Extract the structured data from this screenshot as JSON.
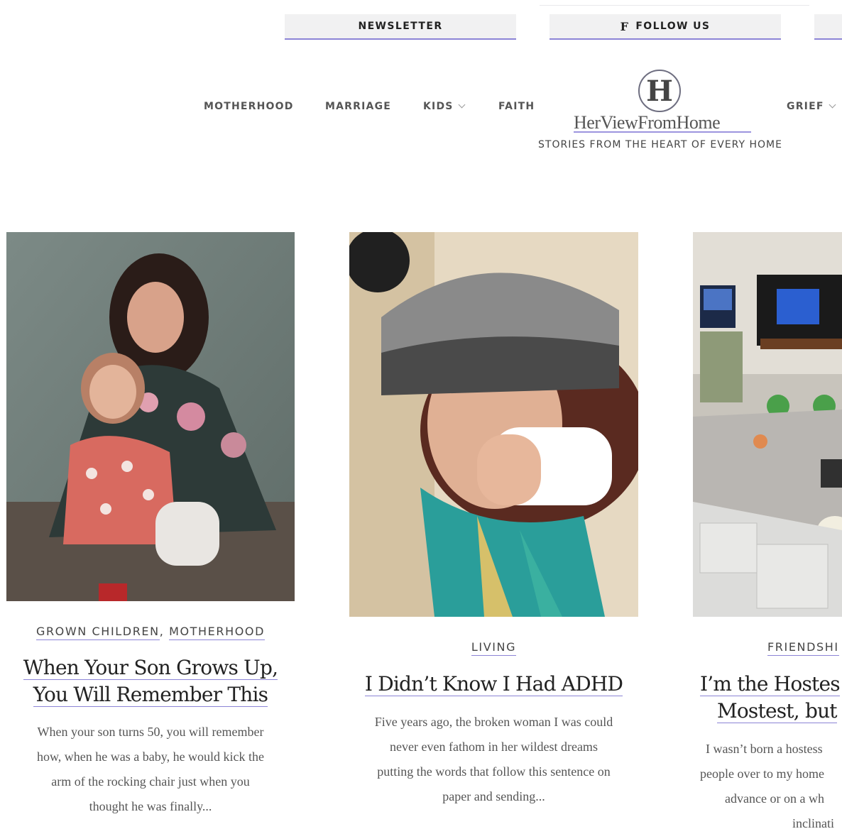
{
  "header": {
    "newsletter_label": "NEWSLETTER",
    "follow_label": "FOLLOW US",
    "follow_icon": "facebook-icon"
  },
  "nav": {
    "items": [
      {
        "label": "MOTHERHOOD"
      },
      {
        "label": "MARRIAGE"
      },
      {
        "label": "KIDS"
      },
      {
        "label": "FAITH"
      },
      {
        "label": "GRIEF"
      }
    ]
  },
  "logo": {
    "letter": "H",
    "name": "HerViewFromHome",
    "tagline": "STORIES FROM THE HEART OF EVERY HOME"
  },
  "cards": [
    {
      "categories": [
        "GROWN CHILDREN",
        "MOTHERHOOD"
      ],
      "title_lines": [
        "When Your Son Grows Up,",
        "You Will Remember This"
      ],
      "excerpt_lines": [
        "When your son turns 50, you will remember",
        "how, when he was a baby, he would kick the",
        "arm of the rocking chair just when you",
        "thought he was finally..."
      ]
    },
    {
      "categories": [
        "LIVING"
      ],
      "title_lines": [
        "I Didn’t Know I Had ADHD"
      ],
      "excerpt_lines": [
        "Five years ago, the broken woman I was could",
        "never even fathom in her wildest dreams",
        "putting the words that follow this sentence on",
        "paper and sending..."
      ]
    },
    {
      "categories": [
        "FRIENDSHI"
      ],
      "title_lines": [
        "I’m the Hostes",
        "Mostest, but"
      ],
      "excerpt_lines": [
        "I wasn’t born a hostess",
        "people over to my home",
        "advance or on a wh",
        "inclinati"
      ]
    }
  ],
  "colors": {
    "accent": "#8c84d6",
    "button_bg": "#f1f1f2",
    "text": "#222222"
  }
}
